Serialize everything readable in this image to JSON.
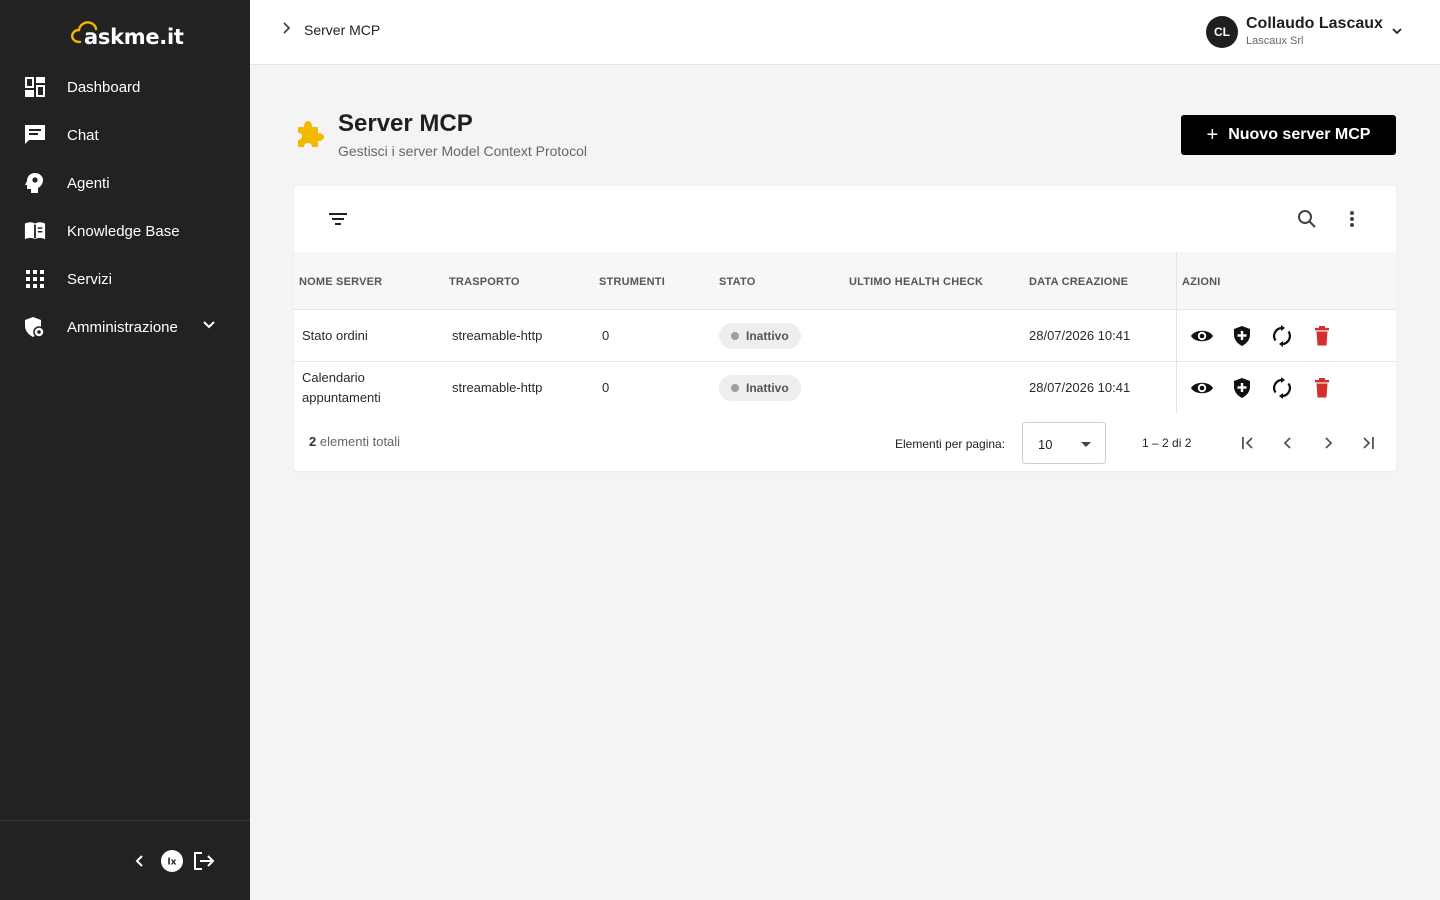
{
  "brand": {
    "name": "askme.it",
    "accent": "#f5b800"
  },
  "sidebar": {
    "items": [
      {
        "label": "Dashboard",
        "icon": "dashboard-icon"
      },
      {
        "label": "Chat",
        "icon": "chat-icon"
      },
      {
        "label": "Agenti",
        "icon": "agent-head-icon"
      },
      {
        "label": "Knowledge Base",
        "icon": "book-icon"
      },
      {
        "label": "Servizi",
        "icon": "grid-icon"
      },
      {
        "label": "Amministrazione",
        "icon": "admin-shield-icon",
        "expandable": true
      }
    ],
    "footer": {
      "collapse_icon": "chevron-left-icon",
      "logo_icon": "lx-logo-icon",
      "logout_icon": "logout-icon"
    }
  },
  "header": {
    "breadcrumb": "Server MCP",
    "user": {
      "initials": "CL",
      "name": "Collaudo Lascaux",
      "org": "Lascaux Srl"
    }
  },
  "page": {
    "title": "Server MCP",
    "subtitle": "Gestisci i server Model Context Protocol",
    "new_button": "Nuovo server MCP",
    "new_button_icon": "+"
  },
  "table": {
    "columns": [
      "NOME SERVER",
      "TRASPORTO",
      "STRUMENTI",
      "STATO",
      "ULTIMO HEALTH CHECK",
      "DATA CREAZIONE",
      "AZIONI"
    ],
    "rows": [
      {
        "name": "Stato ordini",
        "transport": "streamable-http",
        "tools": "0",
        "status": "Inattivo",
        "last_health": "",
        "created": "28/07/2026 10:41"
      },
      {
        "name": "Calendario appuntamenti",
        "transport": "streamable-http",
        "tools": "0",
        "status": "Inattivo",
        "last_health": "",
        "created": "28/07/2026 10:41"
      }
    ],
    "status_color": "#9e9e9e",
    "delete_color": "#d32f2f"
  },
  "pagination": {
    "total_count": "2",
    "total_suffix": "elementi totali",
    "per_page_label": "Elementi per pagina:",
    "per_page_value": "10",
    "range": "1 – 2 di 2"
  }
}
